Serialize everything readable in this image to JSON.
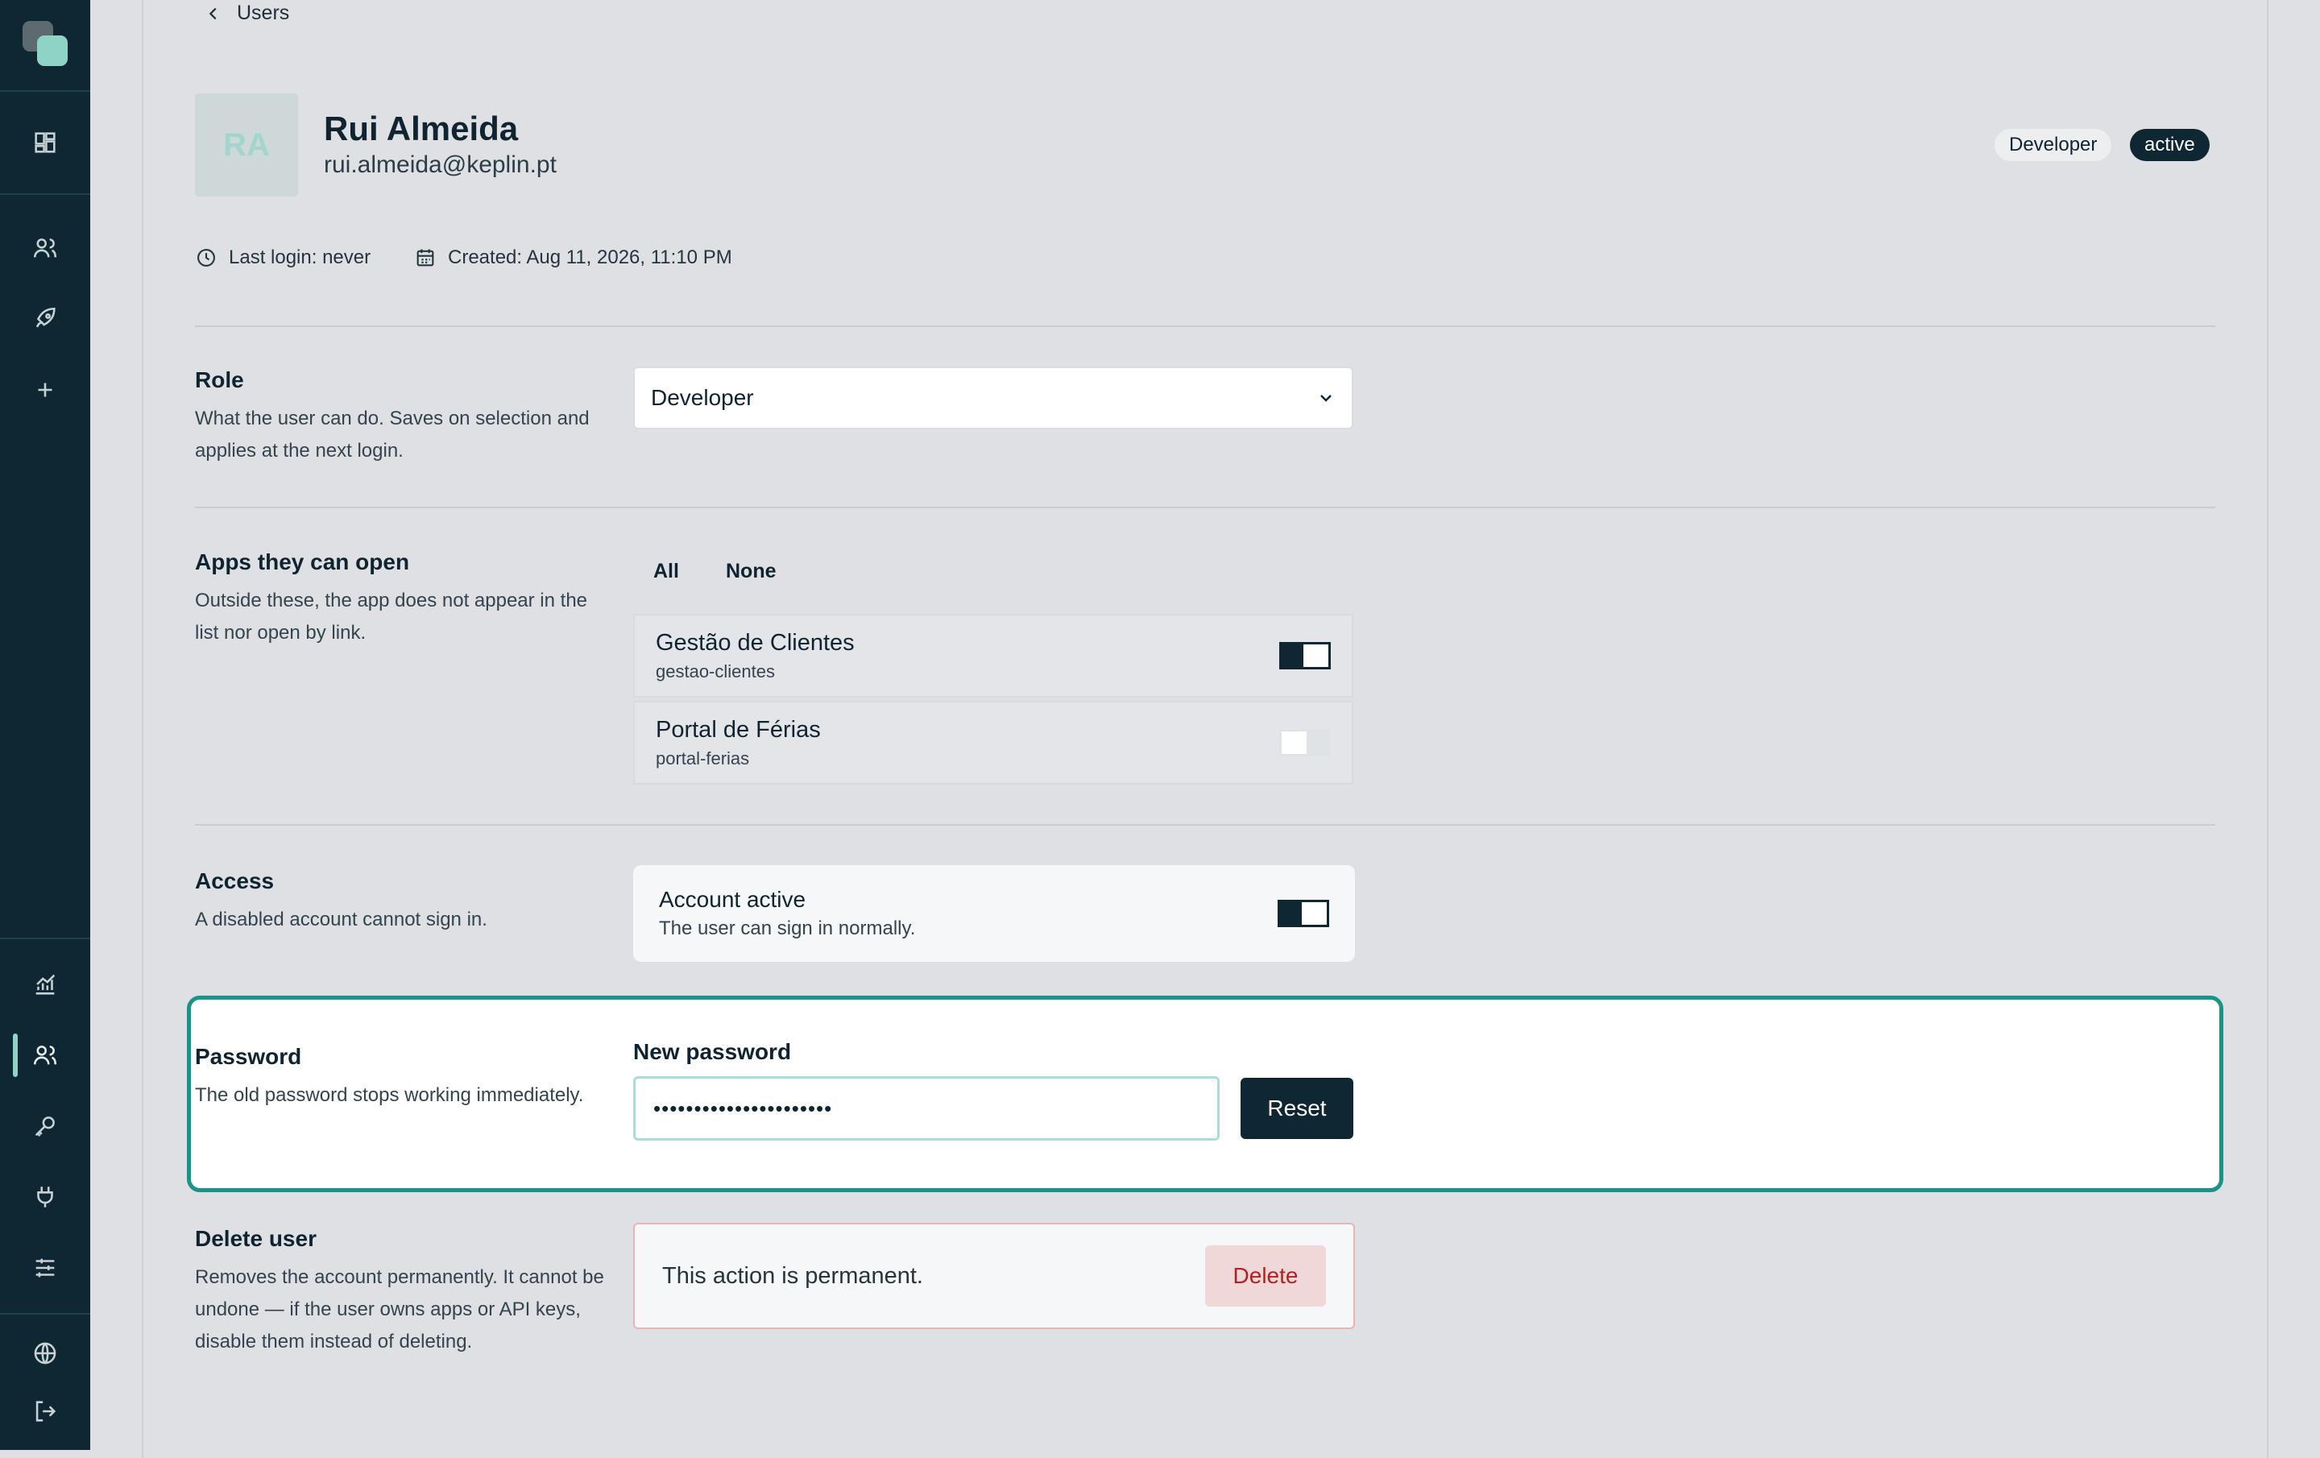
{
  "sidebar": {
    "icons": [
      "logo",
      "dashboard-icon",
      "users-icon",
      "rocket-icon",
      "plus-icon",
      "analytics-icon",
      "users-active-icon",
      "key-icon",
      "plug-icon",
      "sliders-icon",
      "globe-icon",
      "logout-icon"
    ],
    "active_item": "users",
    "accent_color": "#8fd3c7"
  },
  "breadcrumb": {
    "back_label": "Users"
  },
  "user": {
    "initials": "RA",
    "name": "Rui Almeida",
    "email": "rui.almeida@keplin.pt",
    "role_badge": "Developer",
    "status_badge": "active",
    "last_login": "Last login: never",
    "created": "Created: Aug 11, 2026, 11:10 PM"
  },
  "role_section": {
    "title": "Role",
    "description": "What the user can do. Saves on selection and applies at the next login.",
    "selected": "Developer"
  },
  "apps_section": {
    "title": "Apps they can open",
    "description": "Outside these, the app does not appear in the list nor open by link.",
    "all_label": "All",
    "none_label": "None",
    "apps": [
      {
        "name": "Gestão de Clientes",
        "slug": "gestao-clientes",
        "enabled": true
      },
      {
        "name": "Portal de Férias",
        "slug": "portal-ferias",
        "enabled": false
      }
    ]
  },
  "access_section": {
    "title": "Access",
    "description": "A disabled account cannot sign in.",
    "toggle_title": "Account active",
    "toggle_sub": "The user can sign in normally.",
    "enabled": true
  },
  "password_section": {
    "title": "Password",
    "description": "The old password stops working immediately.",
    "field_label": "New password",
    "value": "••••••••••••••••••••••",
    "reset_label": "Reset",
    "highlight_color": "#1a9389"
  },
  "delete_section": {
    "title": "Delete user",
    "description": "Removes the account permanently. It cannot be undone — if the user owns apps or API keys, disable them instead of deleting.",
    "warning": "This action is permanent.",
    "delete_label": "Delete",
    "danger_color": "#b22222"
  }
}
